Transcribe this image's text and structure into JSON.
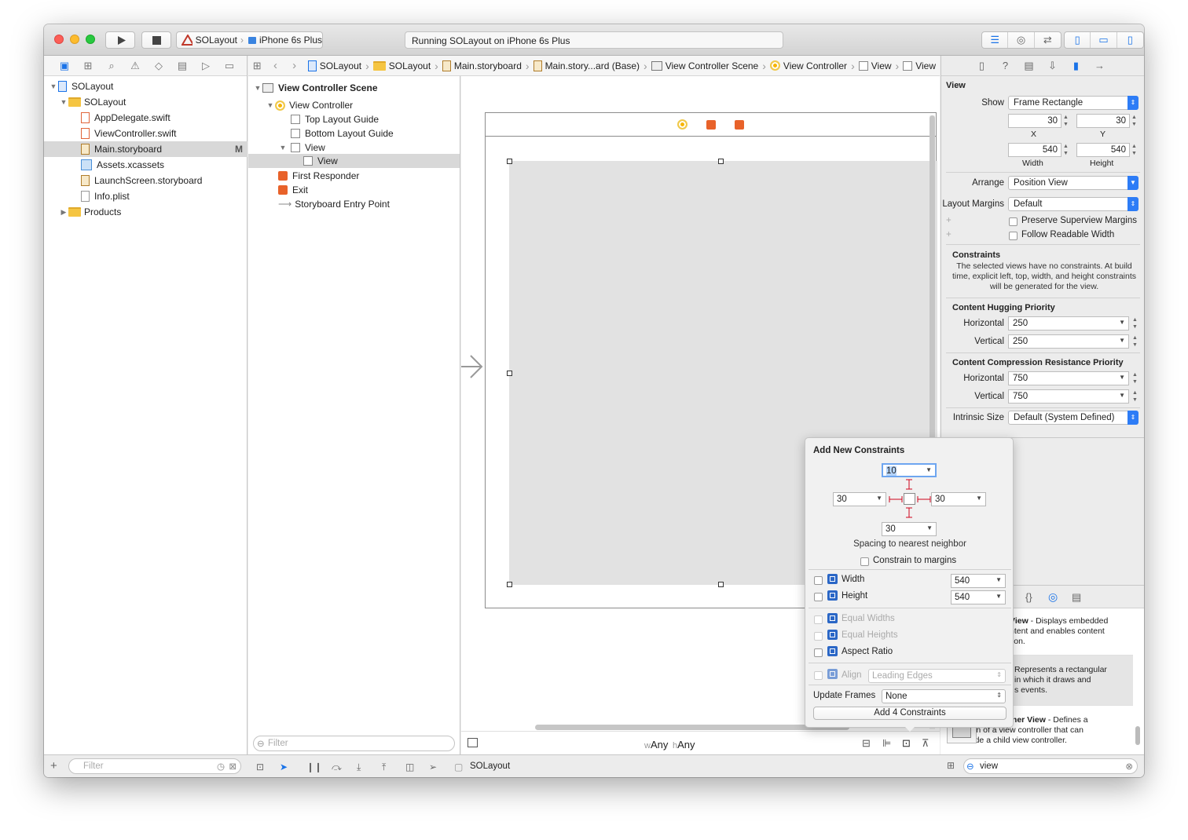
{
  "toolbar": {
    "scheme_target": "SOLayout",
    "scheme_device": "iPhone 6s Plus",
    "status_text": "Running SOLayout on iPhone 6s Plus"
  },
  "navigator": {
    "items": [
      {
        "label": "SOLayout",
        "kind": "project"
      },
      {
        "label": "SOLayout",
        "kind": "group"
      },
      {
        "label": "AppDelegate.swift",
        "kind": "swift"
      },
      {
        "label": "ViewController.swift",
        "kind": "swift"
      },
      {
        "label": "Main.storyboard",
        "kind": "storyboard",
        "badge": "M"
      },
      {
        "label": "Assets.xcassets",
        "kind": "assets"
      },
      {
        "label": "LaunchScreen.storyboard",
        "kind": "storyboard"
      },
      {
        "label": "Info.plist",
        "kind": "plist"
      },
      {
        "label": "Products",
        "kind": "group"
      }
    ],
    "filter_placeholder": "Filter"
  },
  "jumpbar": {
    "crumbs": [
      "SOLayout",
      "SOLayout",
      "Main.storyboard",
      "Main.story...ard (Base)",
      "View Controller Scene",
      "View Controller",
      "View",
      "View"
    ]
  },
  "outline": {
    "items": [
      "View Controller Scene",
      "View Controller",
      "Top Layout Guide",
      "Bottom Layout Guide",
      "View",
      "View",
      "First Responder",
      "Exit",
      "Storyboard Entry Point"
    ],
    "filter_placeholder": "Filter"
  },
  "canvas_bar": {
    "w_prefix": "w",
    "w_value": "Any",
    "h_prefix": "h",
    "h_value": "Any"
  },
  "bottom_bar": {
    "target_label": "SOLayout"
  },
  "inspector": {
    "section_title": "View",
    "show_label": "Show",
    "show_value": "Frame Rectangle",
    "x_value": "30",
    "y_value": "30",
    "x_label": "X",
    "y_label": "Y",
    "width_value": "540",
    "height_value": "540",
    "width_label": "Width",
    "height_label": "Height",
    "arrange_label": "Arrange",
    "arrange_value": "Position View",
    "layout_margins_label": "Layout Margins",
    "layout_margins_value": "Default",
    "preserve_label": "Preserve Superview Margins",
    "follow_label": "Follow Readable Width",
    "constraints_title": "Constraints",
    "constraints_text": "The selected views have no constraints. At build time, explicit left, top, width, and height constraints will be generated for the view.",
    "hugging_title": "Content Hugging Priority",
    "horizontal_label": "Horizontal",
    "vertical_label": "Vertical",
    "hugging_h": "250",
    "hugging_v": "250",
    "compression_title": "Content Compression Resistance Priority",
    "compression_h": "750",
    "compression_v": "750",
    "intrinsic_label": "Intrinsic Size",
    "intrinsic_value": "Default (System Defined)"
  },
  "library": {
    "items": [
      {
        "title": "View",
        "desc_lines": [
          "- Displays embedded",
          "ntent and enables content",
          "tion."
        ]
      },
      {
        "title": "",
        "desc_lines": [
          "Represents a rectangular",
          "in which it draws and",
          "s events."
        ]
      },
      {
        "title": "iner View",
        "desc_lines": [
          "- Defines a",
          "region of a view controller that can",
          "include a child view controller."
        ]
      }
    ],
    "search_value": "view"
  },
  "popover": {
    "title": "Add New Constraints",
    "top": "10",
    "left": "30",
    "right": "30",
    "bottom": "30",
    "spacing_label": "Spacing to nearest neighbor",
    "margins_label": "Constrain to margins",
    "width_label": "Width",
    "width_value": "540",
    "height_label": "Height",
    "height_value": "540",
    "equal_widths": "Equal Widths",
    "equal_heights": "Equal Heights",
    "aspect_ratio": "Aspect Ratio",
    "align_label": "Align",
    "align_value": "Leading Edges",
    "update_frames_label": "Update Frames",
    "update_frames_value": "None",
    "add_button": "Add 4 Constraints"
  }
}
